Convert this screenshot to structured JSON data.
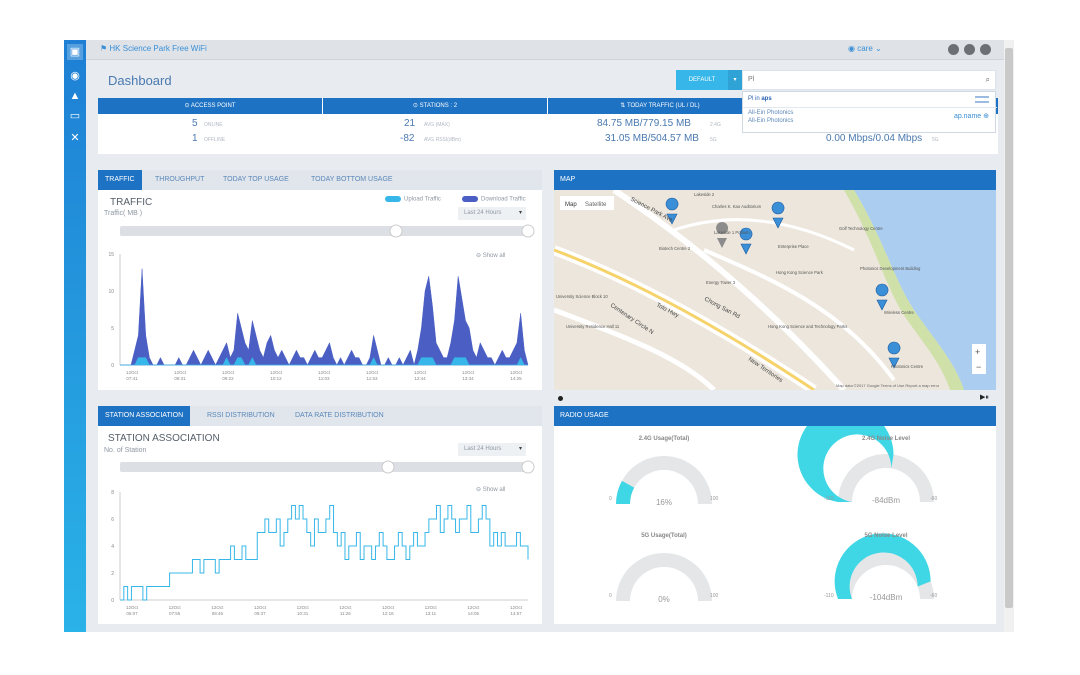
{
  "nav": {
    "icons": [
      "dashboard-icon",
      "wifi-icon",
      "lock-icon",
      "monitor-icon",
      "tools-icon"
    ]
  },
  "topbar": {
    "site": "HK Science Park Free WiFi",
    "user": "care"
  },
  "header": {
    "title": "Dashboard",
    "default_label": "DEFAULT",
    "search_value": "Pl",
    "suggest": {
      "prefix": "Pl in",
      "scope": "aps",
      "item1": "All-Ein Photonics",
      "item2": "All-Ein Photonics",
      "field": "ap.name"
    }
  },
  "stats": {
    "access_point": {
      "header": "ACCESS POINT",
      "online": "5",
      "online_label": "ONLINE",
      "offline": "1",
      "offline_label": "OFFLINE"
    },
    "stations": {
      "header": "STATIONS : 2",
      "v1": "21",
      "l1": "AVG (MAX)",
      "v2": "-82",
      "l2": "AVG RSSI(dBm)"
    },
    "traffic": {
      "header": "TODAY TRAFFIC (UL / DL)",
      "v1": "84.75 MB/779.15 MB",
      "l1": "2.4G",
      "v2": "31.05 MB/504.57 MB",
      "l2": "5G"
    },
    "extra": {
      "v2": "0.00 Mbps/0.04 Mbps",
      "l2": "5G"
    }
  },
  "traffic_panel": {
    "tabs": [
      "TRAFFIC",
      "THROUGHPUT",
      "TODAY TOP USAGE",
      "TODAY BOTTOM USAGE"
    ],
    "title": "TRAFFIC",
    "subtitle": "Traffic( MB )",
    "range": "Last 24 Hours",
    "show_all": "Show all",
    "legend_upload": "Upload Traffic",
    "legend_download": "Download Traffic"
  },
  "station_panel": {
    "tabs": [
      "STATION ASSOCIATION",
      "RSSI DISTRIBUTION",
      "DATA RATE DISTRIBUTION"
    ],
    "title": "STATION ASSOCIATION",
    "subtitle": "No. of Station",
    "range": "Last 24 Hours",
    "show_all": "Show all"
  },
  "map_panel": {
    "header": "MAP",
    "map_btn": "Map",
    "sat_btn": "Satellite",
    "labels": [
      "Lakeside 2",
      "Charles K. Kao Auditorium",
      "Lakeside 1 Podium",
      "Biotech Centre 2",
      "Enterprise Place",
      "Energy Tower 3",
      "Hong Kong Science Park",
      "Photonics Centre",
      "Wireless Centre",
      "Hong Kong Science and Technology Parks",
      "University Science Block 10",
      "University Residence Hall 11",
      "Tolo Hwy",
      "Chong San Rd",
      "Science Park Ave",
      "Centenary Circle N",
      "New Territories",
      "Golf Technology Centre",
      "Photonics Development Building"
    ],
    "footer": "Map data ©2017 Google   Terms of Use   Report a map error"
  },
  "radio_panel": {
    "header": "RADIO USAGE",
    "gauges": [
      {
        "title": "2.4G Usage(Total)",
        "value": "16%",
        "min": "0",
        "max": "100",
        "frac": 0.16
      },
      {
        "title": "2.4G Noise Level",
        "value": "-84dBm",
        "min": "-110",
        "max": "-60",
        "frac": 0.55
      },
      {
        "title": "5G Usage(Total)",
        "value": "0%",
        "min": "0",
        "max": "100",
        "frac": 0
      },
      {
        "title": "5G Noise Level",
        "value": "-104dBm",
        "min": "-110",
        "max": "-60",
        "frac": 0.88
      }
    ]
  },
  "chart_data": [
    {
      "type": "area",
      "title": "TRAFFIC",
      "ylabel": "Traffic( MB )",
      "ylim": [
        0,
        15
      ],
      "yticks": [
        "15",
        "10",
        "5",
        "0"
      ],
      "x_ticks": [
        "12Oct 07:41",
        "12Oct 08:31",
        "12Oct 09:22",
        "12Oct 10:12",
        "12Oct 11:03",
        "12Oct 11:53",
        "12Oct 12:44",
        "12Oct 13:34",
        "12Oct 14:25"
      ],
      "series": [
        {
          "name": "Download Traffic",
          "color": "#4a5ec4",
          "values": [
            0,
            0,
            0,
            0,
            2,
            4,
            13,
            4,
            1,
            0,
            0,
            1,
            0,
            0,
            0,
            0,
            1,
            0,
            0,
            1,
            2,
            1,
            0,
            1,
            2,
            1,
            0,
            1,
            2,
            3,
            1,
            2,
            7,
            5,
            3,
            2,
            6,
            4,
            2,
            1,
            3,
            4,
            2,
            1,
            2,
            1,
            0,
            1,
            2,
            1,
            1,
            0,
            1,
            2,
            1,
            1,
            2,
            3,
            1,
            0,
            1,
            0,
            1,
            2,
            1,
            1,
            0,
            0,
            1,
            4,
            2,
            0,
            0,
            1,
            0,
            0,
            1,
            0,
            1,
            2,
            0,
            2,
            5,
            10,
            12,
            8,
            3,
            2,
            1,
            1,
            3,
            6,
            12,
            9,
            6,
            5,
            2,
            1,
            3,
            2,
            1,
            1,
            0,
            1,
            2,
            1,
            1,
            2,
            3,
            7,
            2,
            0
          ]
        },
        {
          "name": "Upload Traffic",
          "color": "#37b7e9",
          "values": [
            0,
            0,
            0,
            0,
            0,
            1,
            1,
            1,
            0,
            0,
            0,
            0,
            0,
            0,
            0,
            0,
            0,
            0,
            0,
            0,
            0,
            0,
            0,
            0,
            0,
            0,
            0,
            0,
            0,
            1,
            0,
            0,
            1,
            1,
            0,
            0,
            1,
            0,
            0,
            0,
            0,
            0,
            0,
            0,
            0,
            0,
            0,
            0,
            0,
            0,
            0,
            0,
            0,
            0,
            0,
            0,
            0,
            0,
            0,
            0,
            0,
            0,
            0,
            0,
            0,
            0,
            0,
            0,
            0,
            1,
            0,
            0,
            0,
            0,
            0,
            0,
            0,
            0,
            0,
            0,
            0,
            0,
            1,
            1,
            1,
            1,
            0,
            0,
            0,
            0,
            0,
            1,
            1,
            1,
            1,
            0,
            0,
            0,
            0,
            0,
            0,
            0,
            0,
            0,
            0,
            0,
            0,
            0,
            0,
            1,
            0,
            0
          ]
        }
      ]
    },
    {
      "type": "line",
      "title": "STATION ASSOCIATION",
      "ylabel": "No. of Station",
      "ylim": [
        0,
        8
      ],
      "yticks": [
        "8",
        "6",
        "4",
        "2",
        "0"
      ],
      "x_ticks": [
        "12Oct 06:07",
        "12Oct 07:55",
        "12Oct 08:46",
        "12Oct 09:37",
        "12Oct 10:31",
        "12Oct 11:26",
        "12Oct 12:16",
        "12Oct 13:11",
        "12Oct 14:05",
        "12Oct 14:57"
      ],
      "series": [
        {
          "name": "",
          "color": "#37b7e9",
          "values": [
            0,
            1,
            0,
            1,
            1,
            1,
            0,
            1,
            1,
            1,
            1,
            1,
            1,
            2,
            2,
            2,
            2,
            2,
            2,
            3,
            3,
            2,
            3,
            3,
            3,
            2,
            3,
            3,
            3,
            4,
            3,
            3,
            4,
            3,
            3,
            3,
            5,
            5,
            6,
            5,
            5,
            6,
            4,
            5,
            6,
            7,
            6,
            7,
            6,
            5,
            4,
            6,
            5,
            5,
            6,
            7,
            5,
            4,
            5,
            3,
            4,
            4,
            5,
            3,
            4,
            4,
            3,
            4,
            5,
            4,
            3,
            3,
            4,
            5,
            4,
            3,
            4,
            5,
            4,
            4,
            5,
            6,
            6,
            7,
            5,
            6,
            7,
            6,
            5,
            6,
            6,
            7,
            5,
            5,
            6,
            7,
            6,
            4,
            5,
            4,
            5,
            4,
            4,
            4,
            5,
            4,
            4,
            3
          ]
        }
      ]
    }
  ]
}
